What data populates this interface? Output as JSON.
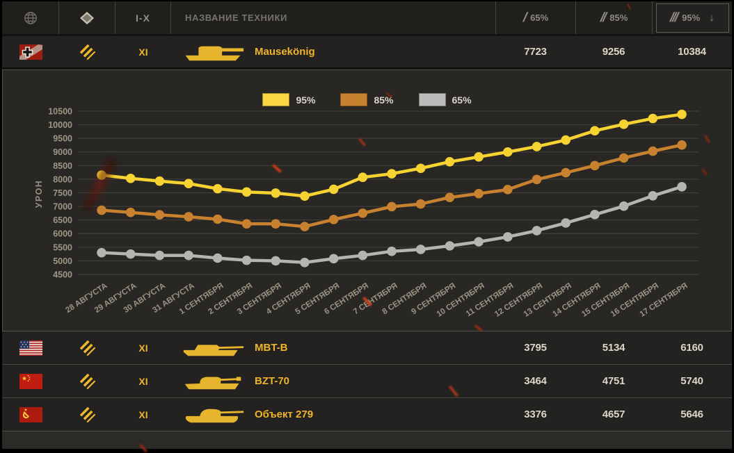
{
  "header": {
    "tier_filter_label": "I-X",
    "search_placeholder": "НАЗВАНИЕ ТЕХНИКИ",
    "stat_columns": [
      {
        "slashes": "/",
        "label": "65%"
      },
      {
        "slashes": "//",
        "label": "85%"
      },
      {
        "slashes": "///",
        "label": "95%"
      }
    ],
    "sort_arrow": "↓",
    "icons": {
      "nation_filter": "globe-icon",
      "class_filter": "diamond-marker-icon"
    }
  },
  "legend": [
    {
      "label": "95%",
      "color": "#fbd843"
    },
    {
      "label": "85%",
      "color": "#c8812f"
    },
    {
      "label": "65%",
      "color": "#bdbcba"
    }
  ],
  "rows": [
    {
      "nation": "Germany",
      "tier": "XI",
      "name": "Mausekönig",
      "values": [
        "7723",
        "9256",
        "10384"
      ]
    },
    {
      "nation": "USA",
      "tier": "XI",
      "name": "MBT-B",
      "values": [
        "3795",
        "5134",
        "6160"
      ]
    },
    {
      "nation": "China",
      "tier": "XI",
      "name": "BZT-70",
      "values": [
        "3464",
        "4751",
        "5740"
      ]
    },
    {
      "nation": "USSR",
      "tier": "XI",
      "name": "Объект 279",
      "values": [
        "3376",
        "4657",
        "5646"
      ]
    }
  ],
  "colors": {
    "accent_gold": "#efb42a",
    "value_text": "#dad6c8",
    "panel_background": "#282724",
    "row_background": "#232220"
  },
  "chart_data": {
    "type": "line",
    "title": "",
    "xlabel": "",
    "ylabel": "УРОН",
    "ylim": [
      4500,
      10500
    ],
    "ytick_step": 500,
    "grid": true,
    "legend_position": "top-center",
    "categories": [
      "28 АВГУСТА",
      "29 АВГУСТА",
      "30 АВГУСТА",
      "31 АВГУСТА",
      "1 СЕНТЯБРЯ",
      "2 СЕНТЯБРЯ",
      "3 СЕНТЯБРЯ",
      "4 СЕНТЯБРЯ",
      "5 СЕНТЯБРЯ",
      "6 СЕНТЯБРЯ",
      "7 СЕНТЯБРЯ",
      "8 СЕНТЯБРЯ",
      "9 СЕНТЯБРЯ",
      "10 СЕНТЯБРЯ",
      "11 СЕНТЯБРЯ",
      "12 СЕНТЯБРЯ",
      "13 СЕНТЯБРЯ",
      "14 СЕНТЯБРЯ",
      "15 СЕНТЯБРЯ",
      "16 СЕНТЯБРЯ",
      "17 СЕНТЯБРЯ"
    ],
    "series": [
      {
        "name": "95%",
        "color": "#f6d330",
        "values": [
          8150,
          8030,
          7930,
          7840,
          7650,
          7530,
          7490,
          7380,
          7630,
          8070,
          8200,
          8400,
          8640,
          8820,
          9000,
          9200,
          9440,
          9780,
          10020,
          10230,
          10384
        ]
      },
      {
        "name": "85%",
        "color": "#c8812f",
        "values": [
          6860,
          6780,
          6690,
          6620,
          6530,
          6360,
          6360,
          6260,
          6520,
          6750,
          6990,
          7090,
          7330,
          7470,
          7620,
          7990,
          8240,
          8500,
          8780,
          9030,
          9256
        ]
      },
      {
        "name": "65%",
        "color": "#b5b4b1",
        "values": [
          5300,
          5250,
          5200,
          5200,
          5100,
          5020,
          5000,
          4940,
          5080,
          5200,
          5350,
          5420,
          5550,
          5700,
          5880,
          6110,
          6390,
          6700,
          7010,
          7390,
          7723
        ]
      }
    ]
  }
}
